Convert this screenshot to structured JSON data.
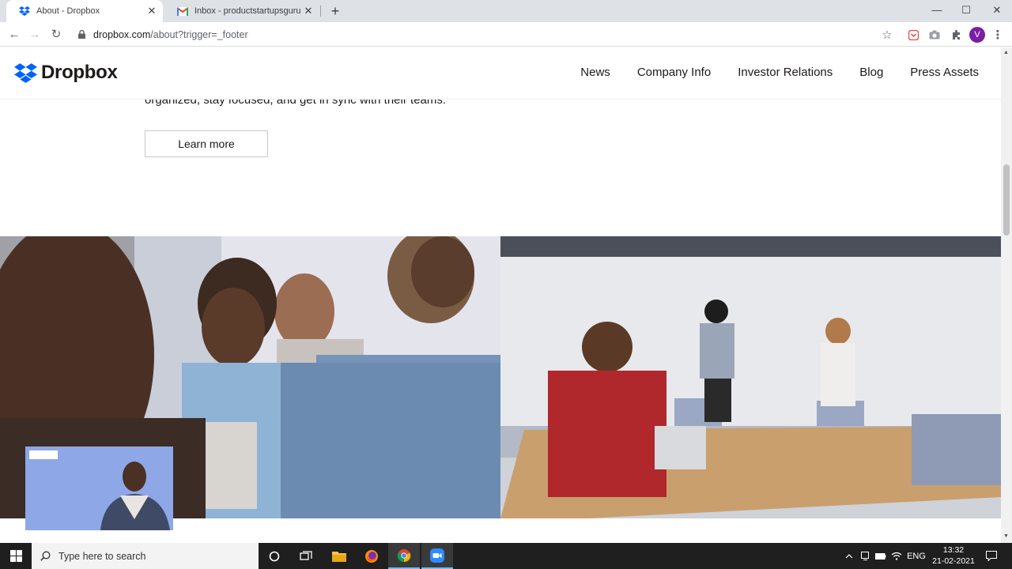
{
  "browser": {
    "tabs": [
      {
        "title": "About - Dropbox",
        "active": true
      },
      {
        "title": "Inbox - productstartupsguru@gr",
        "active": false
      }
    ],
    "url_host": "dropbox.com",
    "url_path": "/about?trigger=_footer",
    "profile_initial": "V"
  },
  "site": {
    "logo_text": "Dropbox",
    "nav": [
      "News",
      "Company Info",
      "Investor Relations",
      "Blog",
      "Press Assets"
    ],
    "partial_text": "organized, stay focused, and get in sync with their teams.",
    "learn_more": "Learn more"
  },
  "taskbar": {
    "search_placeholder": "Type here to search",
    "lang": "ENG",
    "time": "13:32",
    "date": "21-02-2021"
  },
  "colors": {
    "dropbox_blue": "#0061fe",
    "text": "#1e1919",
    "taskbar": "#1f1f1f"
  }
}
